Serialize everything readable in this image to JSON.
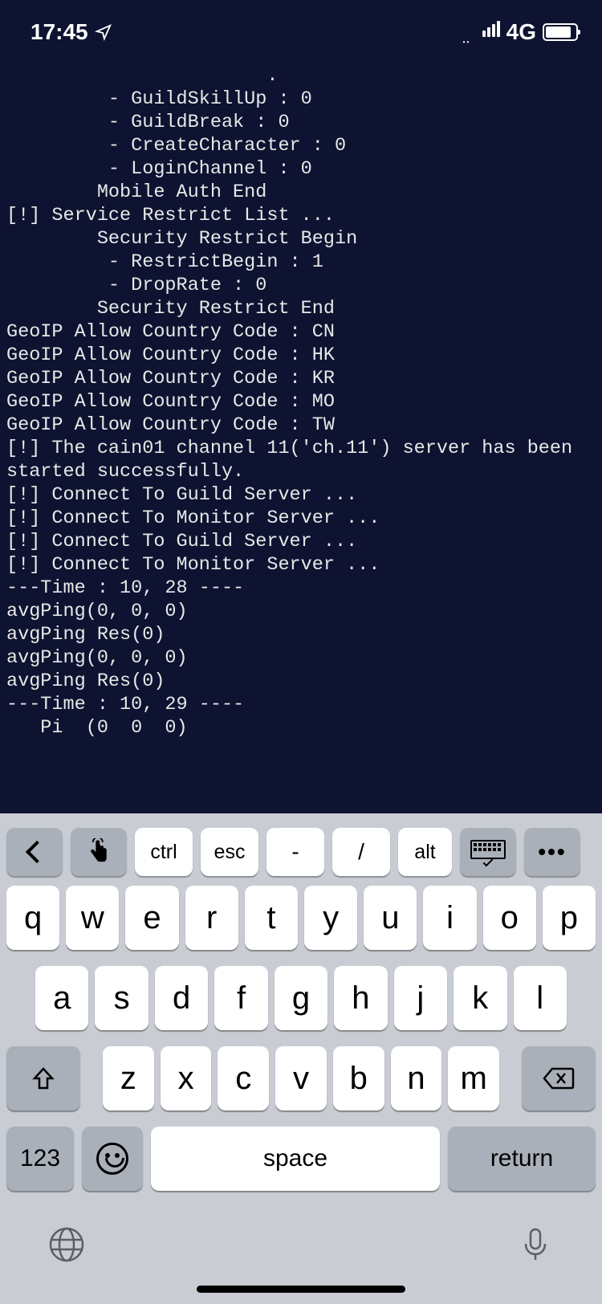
{
  "status_bar": {
    "time": "17:45",
    "network": "4G"
  },
  "terminal": {
    "lines": [
      "                       .",
      "         - GuildSkillUp : 0",
      "         - GuildBreak : 0",
      "         - CreateCharacter : 0",
      "         - LoginChannel : 0",
      "        Mobile Auth End",
      "[!] Service Restrict List ...",
      "        Security Restrict Begin",
      "         - RestrictBegin : 1",
      "         - DropRate : 0",
      "        Security Restrict End",
      "GeoIP Allow Country Code : CN",
      "GeoIP Allow Country Code : HK",
      "GeoIP Allow Country Code : KR",
      "GeoIP Allow Country Code : MO",
      "GeoIP Allow Country Code : TW",
      "[!] The cain01 channel 11('ch.11') server has been",
      "started successfully.",
      "[!] Connect To Guild Server ...",
      "[!] Connect To Monitor Server ...",
      "[!] Connect To Guild Server ...",
      "[!] Connect To Monitor Server ...",
      "---Time : 10, 28 ----",
      "avgPing(0, 0, 0)",
      "avgPing Res(0)",
      "avgPing(0, 0, 0)",
      "avgPing Res(0)",
      "---Time : 10, 29 ----",
      "   Pi  (0  0  0)"
    ]
  },
  "accessory": {
    "ctrl": "ctrl",
    "esc": "esc",
    "dash": "-",
    "slash": "/",
    "alt": "alt",
    "more": "•••"
  },
  "keyboard": {
    "row1": [
      "q",
      "w",
      "e",
      "r",
      "t",
      "y",
      "u",
      "i",
      "o",
      "p"
    ],
    "row2": [
      "a",
      "s",
      "d",
      "f",
      "g",
      "h",
      "j",
      "k",
      "l"
    ],
    "row3": [
      "z",
      "x",
      "c",
      "v",
      "b",
      "n",
      "m"
    ],
    "numbers": "123",
    "space": "space",
    "return": "return"
  }
}
